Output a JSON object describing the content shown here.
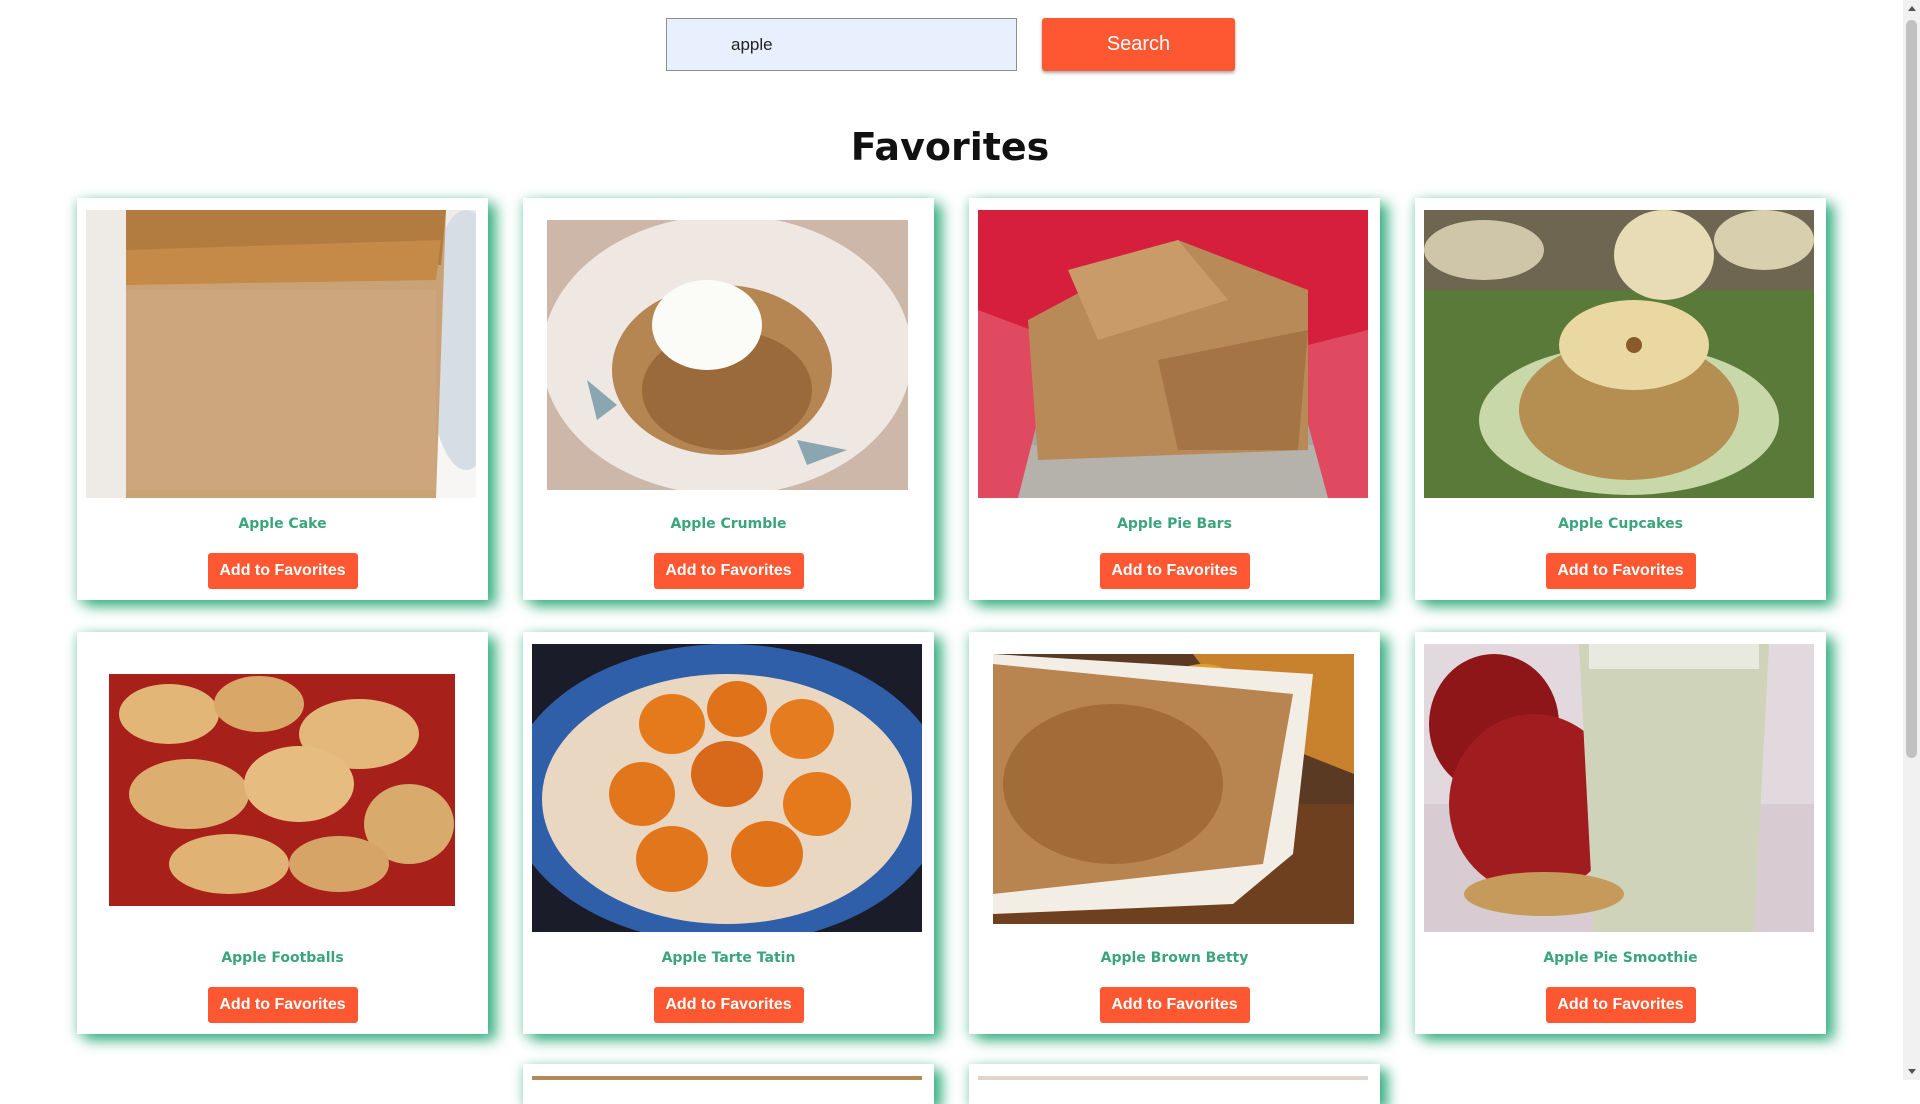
{
  "search": {
    "value": "apple",
    "button_label": "Search"
  },
  "heading": "Favorites",
  "recipes": [
    {
      "title": "Apple Cake",
      "button_label": "Add to Favorites",
      "image": "apple-cake-photo"
    },
    {
      "title": "Apple Crumble",
      "button_label": "Add to Favorites",
      "image": "apple-crumble-photo"
    },
    {
      "title": "Apple Pie Bars",
      "button_label": "Add to Favorites",
      "image": "apple-pie-bars-photo"
    },
    {
      "title": "Apple Cupcakes",
      "button_label": "Add to Favorites",
      "image": "apple-cupcakes-photo"
    },
    {
      "title": "Apple Footballs",
      "button_label": "Add to Favorites",
      "image": "apple-footballs-photo"
    },
    {
      "title": "Apple Tarte Tatin",
      "button_label": "Add to Favorites",
      "image": "apple-tarte-tatin-photo"
    },
    {
      "title": "Apple Brown Betty",
      "button_label": "Add to Favorites",
      "image": "apple-brown-betty-photo"
    },
    {
      "title": "Apple Pie Smoothie",
      "button_label": "Add to Favorites",
      "image": "apple-pie-smoothie-photo"
    }
  ],
  "colors": {
    "accent": "#fe5833",
    "title_green": "#3aa57c",
    "card_shadow": "#27a878",
    "input_bg": "#e8f0fe"
  }
}
